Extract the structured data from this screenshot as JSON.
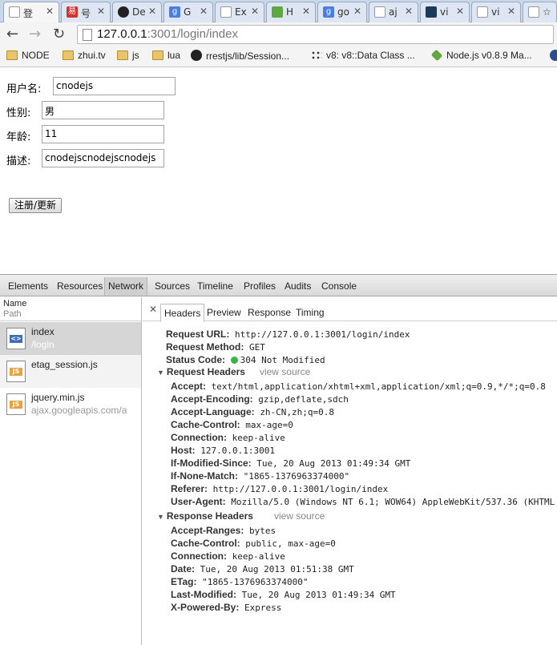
{
  "browser": {
    "tabs": [
      {
        "title": "登",
        "icon": "page-icon",
        "active": true
      },
      {
        "title": "号",
        "icon": "netease-icon"
      },
      {
        "title": "De",
        "icon": "github-icon"
      },
      {
        "title": "G",
        "icon": "google-icon"
      },
      {
        "title": "Ex",
        "icon": "page-icon"
      },
      {
        "title": "H",
        "icon": "nodejs-icon"
      },
      {
        "title": "go",
        "icon": "google-icon"
      },
      {
        "title": "aj",
        "icon": "page-icon"
      },
      {
        "title": "vi",
        "icon": "site-icon"
      },
      {
        "title": "vi",
        "icon": "page-icon"
      },
      {
        "title": "☆",
        "icon": "page-icon"
      }
    ],
    "address": {
      "host": "127.0.0.1",
      "rest": ":3001/login/index"
    },
    "bookmarks": [
      {
        "label": "NODE",
        "icon": "folder-icon"
      },
      {
        "label": "zhui.tv",
        "icon": "folder-icon"
      },
      {
        "label": "js",
        "icon": "folder-icon"
      },
      {
        "label": "lua",
        "icon": "folder-icon"
      },
      {
        "label": "rrestjs/lib/Session...",
        "icon": "github-icon"
      },
      {
        "label": "v8: v8::Data Class ...",
        "icon": "v8-icon"
      },
      {
        "label": "Node.js v0.8.9 Ma...",
        "icon": "nodejs-icon"
      },
      {
        "label": "",
        "icon": "globe-icon"
      }
    ]
  },
  "form": {
    "fields": [
      {
        "label": "用户名:",
        "value": "cnodejs"
      },
      {
        "label": "性别:",
        "value": "男"
      },
      {
        "label": "年龄:",
        "value": "11"
      },
      {
        "label": "描述:",
        "value": "cnodejscnodejscnodejs"
      }
    ],
    "submit_label": "注册/更新"
  },
  "devtools": {
    "panels": [
      "Elements",
      "Resources",
      "Network",
      "Sources",
      "Timeline",
      "Profiles",
      "Audits",
      "Console"
    ],
    "selected_panel": "Network",
    "list_header": {
      "name": "Name",
      "path": "Path"
    },
    "requests": [
      {
        "name": "index",
        "path": "/login",
        "type": "html"
      },
      {
        "name": "etag_session.js",
        "path": "",
        "type": "js"
      },
      {
        "name": "jquery.min.js",
        "path": "ajax.googleapis.com/a",
        "type": "js"
      }
    ],
    "detail_tabs": [
      "Headers",
      "Preview",
      "Response",
      "Timing"
    ],
    "selected_detail_tab": "Headers",
    "general": [
      {
        "key": "Request URL:",
        "value": "http://127.0.0.1:3001/login/index"
      },
      {
        "key": "Request Method:",
        "value": "GET"
      },
      {
        "key": "Status Code:",
        "value": "304 Not Modified"
      }
    ],
    "status_color": "#39b54a",
    "request_headers_title": "Request Headers",
    "response_headers_title": "Response Headers",
    "view_source": "view source",
    "request_headers": [
      {
        "key": "Accept:",
        "value": "text/html,application/xhtml+xml,application/xml;q=0.9,*/*;q=0.8"
      },
      {
        "key": "Accept-Encoding:",
        "value": "gzip,deflate,sdch"
      },
      {
        "key": "Accept-Language:",
        "value": "zh-CN,zh;q=0.8"
      },
      {
        "key": "Cache-Control:",
        "value": "max-age=0"
      },
      {
        "key": "Connection:",
        "value": "keep-alive"
      },
      {
        "key": "Host:",
        "value": "127.0.0.1:3001"
      },
      {
        "key": "If-Modified-Since:",
        "value": "Tue, 20 Aug 2013 01:49:34 GMT"
      },
      {
        "key": "If-None-Match:",
        "value": "\"1865-1376963374000\""
      },
      {
        "key": "Referer:",
        "value": "http://127.0.0.1:3001/login/index"
      },
      {
        "key": "User-Agent:",
        "value": "Mozilla/5.0 (Windows NT 6.1; WOW64) AppleWebKit/537.36 (KHTML"
      }
    ],
    "response_headers": [
      {
        "key": "Accept-Ranges:",
        "value": "bytes"
      },
      {
        "key": "Cache-Control:",
        "value": "public, max-age=0"
      },
      {
        "key": "Connection:",
        "value": "keep-alive"
      },
      {
        "key": "Date:",
        "value": "Tue, 20 Aug 2013 01:51:38 GMT"
      },
      {
        "key": "ETag:",
        "value": "\"1865-1376963374000\""
      },
      {
        "key": "Last-Modified:",
        "value": "Tue, 20 Aug 2013 01:49:34 GMT"
      },
      {
        "key": "X-Powered-By:",
        "value": "Express"
      }
    ]
  }
}
